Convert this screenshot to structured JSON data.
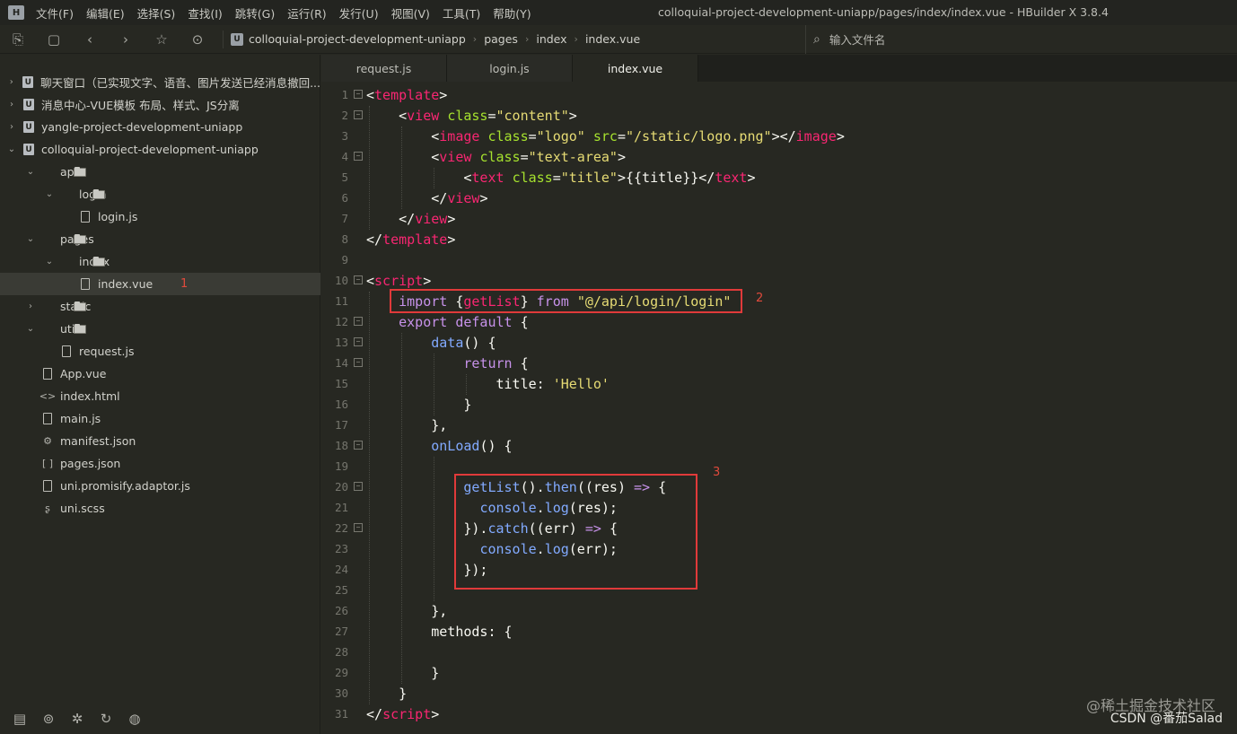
{
  "menubar": {
    "logo": "H",
    "items": [
      "文件(F)",
      "编辑(E)",
      "选择(S)",
      "查找(I)",
      "跳转(G)",
      "运行(R)",
      "发行(U)",
      "视图(V)",
      "工具(T)",
      "帮助(Y)"
    ],
    "window_title": "colloquial-project-development-uniapp/pages/index/index.vue - HBuilder X 3.8.4"
  },
  "toolbar": {
    "breadcrumb": [
      "colloquial-project-development-uniapp",
      "pages",
      "index",
      "index.vue"
    ],
    "search_placeholder": "输入文件名"
  },
  "sidebar": {
    "items": [
      {
        "label": "聊天窗口（已实现文字、语音、图片发送已经消息撤回..."
      },
      {
        "label": "消息中心-VUE模板 布局、样式、JS分离"
      },
      {
        "label": "yangle-project-development-uniapp"
      },
      {
        "label": "colloquial-project-development-uniapp"
      },
      {
        "label": "api"
      },
      {
        "label": "login"
      },
      {
        "label": "login.js"
      },
      {
        "label": "pages"
      },
      {
        "label": "index"
      },
      {
        "label": "index.vue",
        "annotation": "1"
      },
      {
        "label": "static"
      },
      {
        "label": "utils"
      },
      {
        "label": "request.js"
      },
      {
        "label": "App.vue"
      },
      {
        "label": "index.html"
      },
      {
        "label": "main.js"
      },
      {
        "label": "manifest.json"
      },
      {
        "label": "pages.json"
      },
      {
        "label": "uni.promisify.adaptor.js"
      },
      {
        "label": "uni.scss"
      }
    ]
  },
  "tabs": [
    {
      "label": "request.js"
    },
    {
      "label": "login.js"
    },
    {
      "label": "index.vue"
    }
  ],
  "editor": {
    "line_numbers": [
      "1",
      "2",
      "3",
      "4",
      "5",
      "6",
      "7",
      "8",
      "9",
      "10",
      "11",
      "12",
      "13",
      "14",
      "15",
      "16",
      "17",
      "18",
      "19",
      "20",
      "21",
      "22",
      "23",
      "24",
      "25",
      "26",
      "27",
      "28",
      "29",
      "30",
      "31"
    ],
    "annotations": [
      "2",
      "3"
    ]
  },
  "watermark": "@稀土掘金技术社区",
  "credit": "CSDN @番茄Salad"
}
